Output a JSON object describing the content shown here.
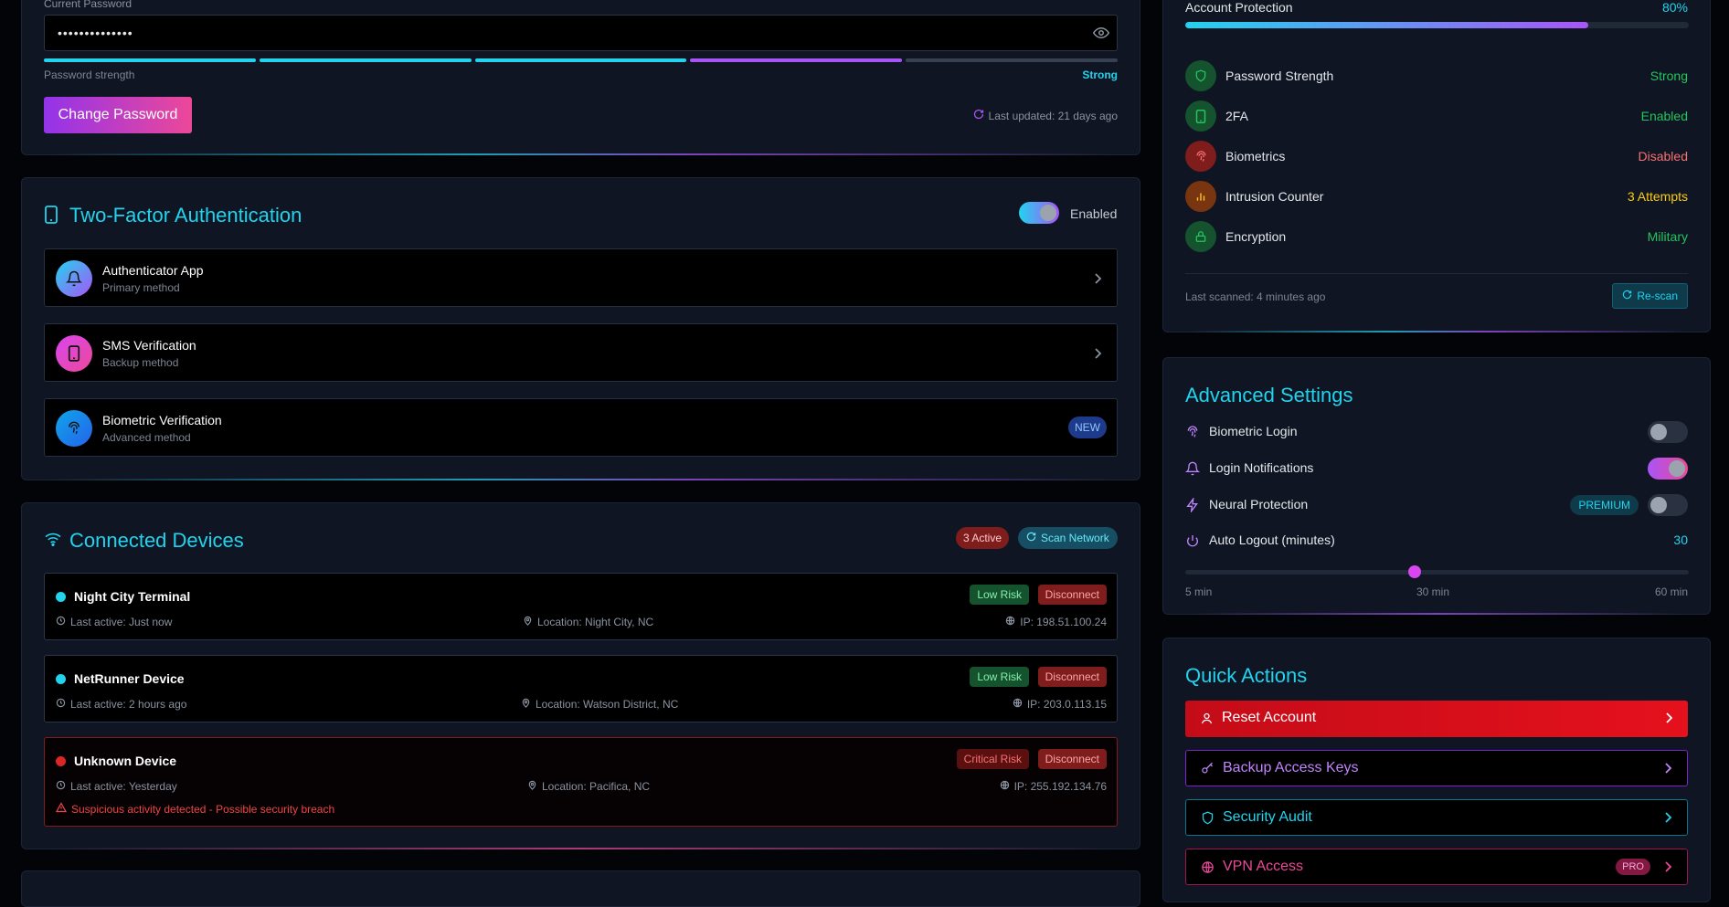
{
  "password": {
    "label": "Current Password",
    "value": "••••••••••••••",
    "strength_label": "Password strength",
    "strength_value": "Strong",
    "strength_segments_filled": 4,
    "strength_segments_total": 5,
    "change_button": "Change Password",
    "last_updated": "Last updated: 21 days ago"
  },
  "two_factor": {
    "title": "Two-Factor Authentication",
    "toggle_label": "Enabled",
    "methods": [
      {
        "name": "Authenticator App",
        "sub": "Primary method"
      },
      {
        "name": "SMS Verification",
        "sub": "Backup method"
      },
      {
        "name": "Biometric Verification",
        "sub": "Advanced method",
        "badge": "NEW"
      }
    ]
  },
  "devices": {
    "title": "Connected Devices",
    "active_badge": "3 Active",
    "scan_button": "Scan Network",
    "list": [
      {
        "name": "Night City Terminal",
        "risk": "Low Risk",
        "disconnect": "Disconnect",
        "last_active": "Last active: Just now",
        "location": "Location: Night City, NC",
        "ip": "IP: 198.51.100.24"
      },
      {
        "name": "NetRunner Device",
        "risk": "Low Risk",
        "disconnect": "Disconnect",
        "last_active": "Last active: 2 hours ago",
        "location": "Location: Watson District, NC",
        "ip": "IP: 203.0.113.15"
      },
      {
        "name": "Unknown Device",
        "risk": "Critical Risk",
        "disconnect": "Disconnect",
        "last_active": "Last active: Yesterday",
        "location": "Location: Pacifica, NC",
        "ip": "IP: 255.192.134.76",
        "warning": "Suspicious activity detected - Possible security breach"
      }
    ]
  },
  "protection": {
    "label": "Account Protection",
    "percent_text": "80%",
    "percent": 80,
    "stats": [
      {
        "label": "Password Strength",
        "value": "Strong",
        "color": "#22c55e"
      },
      {
        "label": "2FA",
        "value": "Enabled",
        "color": "#22c55e"
      },
      {
        "label": "Biometrics",
        "value": "Disabled",
        "color": "#ef4444"
      },
      {
        "label": "Intrusion Counter",
        "value": "3 Attempts",
        "color": "#facc15"
      },
      {
        "label": "Encryption",
        "value": "Military",
        "color": "#22c55e"
      }
    ],
    "last_scanned": "Last scanned: 4 minutes ago",
    "rescan": "Re-scan"
  },
  "advanced": {
    "title": "Advanced Settings",
    "biometric_login": "Biometric Login",
    "login_notifications": "Login Notifications",
    "neural_protection": "Neural Protection",
    "premium_badge": "PREMIUM",
    "auto_logout": "Auto Logout (minutes)",
    "auto_logout_value": "30",
    "slider_min": "5 min",
    "slider_mid": "30 min",
    "slider_max": "60 min",
    "slider_fraction": 0.455
  },
  "quick_actions": {
    "title": "Quick Actions",
    "reset": "Reset Account",
    "backup": "Backup Access Keys",
    "audit": "Security Audit",
    "vpn": "VPN Access",
    "vpn_badge": "PRO"
  }
}
